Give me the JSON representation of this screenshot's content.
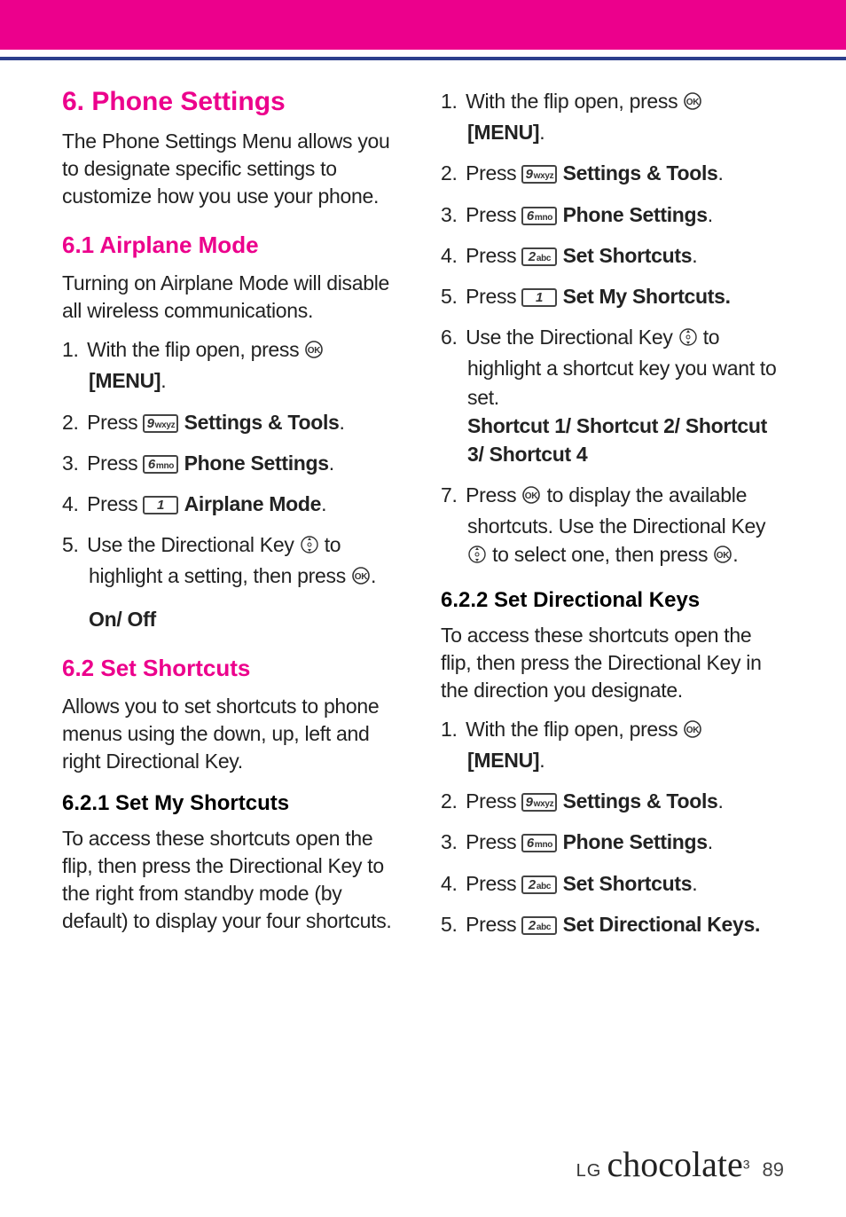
{
  "header": {
    "section_title": "6. Phone Settings",
    "section_intro": "The Phone Settings Menu allows you to designate specific settings to customize how you use your phone."
  },
  "s61": {
    "title": "6.1 Airplane Mode",
    "intro": "Turning on Airplane Mode will disable all wireless communications.",
    "step1a": "With the flip open, press ",
    "step1b": "[MENU]",
    "step2a": "Press ",
    "step2b": "Settings & Tools",
    "step3a": "Press ",
    "step3b": "Phone Settings",
    "step4a": "Press ",
    "step4b": "Airplane Mode",
    "step5a": "Use the Directional Key ",
    "step5b": " to highlight a setting, then press ",
    "onoff": "On/ Off"
  },
  "s62": {
    "title": "6.2 Set Shortcuts",
    "intro": "Allows you to set shortcuts to phone menus using the down, up, left and right Directional Key."
  },
  "s621": {
    "title": "6.2.1 Set My Shortcuts",
    "intro": "To access these shortcuts open the flip, then press the Directional Key to the right from standby mode (by default) to display your four shortcuts.",
    "step1a": "With the flip open, press ",
    "step1b": "[MENU]",
    "step2a": "Press ",
    "step2b": "Settings & Tools",
    "step3a": "Press ",
    "step3b": "Phone Settings",
    "step4a": "Press ",
    "step4b": "Set Shortcuts",
    "step5a": "Press ",
    "step5b": "Set My Shortcuts.",
    "step6a": "Use the Directional Key ",
    "step6b": " to highlight a shortcut key you want to set.",
    "step6c": "Shortcut 1/ Shortcut 2/ Shortcut 3/ Shortcut 4",
    "step7a": "Press ",
    "step7b": " to display the available shortcuts. Use the Directional Key ",
    "step7c": " to select one, then press "
  },
  "s622": {
    "title": "6.2.2 Set Directional Keys",
    "intro": "To access these shortcuts open the flip, then press the Directional Key in the direction you designate.",
    "step1a": "With the flip open, press ",
    "step1b": "[MENU]",
    "step2a": "Press ",
    "step2b": "Settings & Tools",
    "step3a": "Press ",
    "step3b": "Phone Settings",
    "step4a": "Press ",
    "step4b": "Set Shortcuts",
    "step5a": "Press ",
    "step5b": "Set Directional Keys."
  },
  "keys": {
    "k9": "9",
    "k9s": "wxyz",
    "k6": "6",
    "k6s": "mno",
    "k1": "1",
    "k1s": "",
    "k2": "2",
    "k2s": "abc"
  },
  "footer": {
    "lg": "LG",
    "choc": "chocolate",
    "sup": "3",
    "page": "89"
  },
  "nums": {
    "n1": "1.",
    "n2": "2.",
    "n3": "3.",
    "n4": "4.",
    "n5": "5.",
    "n6": "6.",
    "n7": "7."
  },
  "punct": {
    "period": ".",
    "colonspace": " "
  }
}
